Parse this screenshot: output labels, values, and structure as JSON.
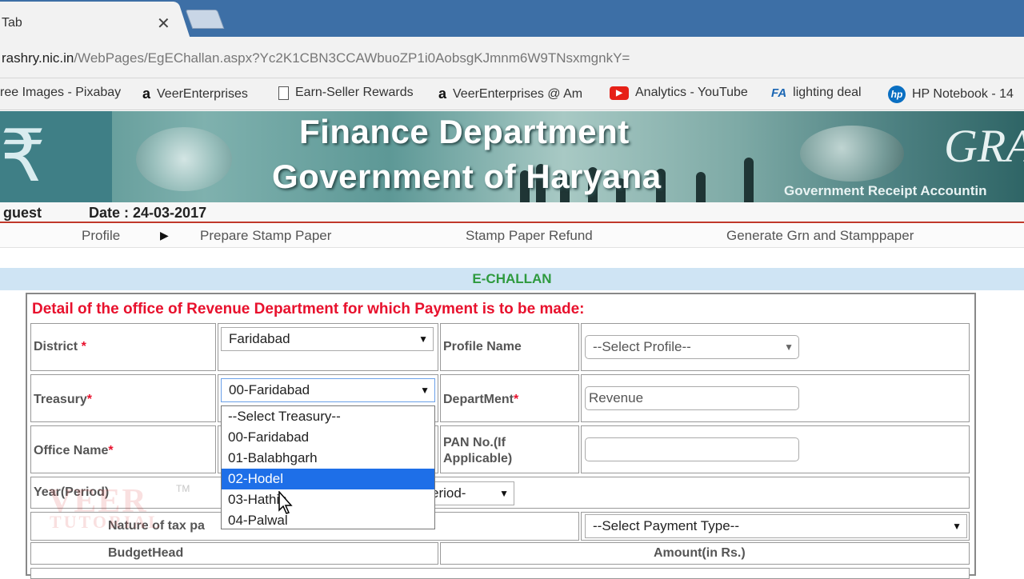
{
  "browser": {
    "tab_title": "Tab",
    "close_glyph": "✕",
    "url_host": "rashry.nic.in",
    "url_path": "/WebPages/EgEChallan.aspx?Yc2K1CBN3CCAWbuoZP1i0AobsgKJmnm6W9TNsxmgnkY=",
    "bookmarks": [
      {
        "label": "ree Images - Pixabay",
        "icon": "pixabay-icon"
      },
      {
        "label": "VeerEnterprises",
        "icon": "amazon-icon"
      },
      {
        "label": "Earn-Seller Rewards",
        "icon": "page-icon"
      },
      {
        "label": "VeerEnterprises @ Am",
        "icon": "amazon-icon"
      },
      {
        "label": "Analytics - YouTube",
        "icon": "youtube-icon"
      },
      {
        "label": "lighting deal",
        "icon": "fa-icon"
      },
      {
        "label": "HP Notebook - 14",
        "icon": "hp-icon"
      }
    ]
  },
  "banner": {
    "line1": "Finance Department",
    "line2": "Government of Haryana",
    "logo_letters": "GRA",
    "subtitle": "Government Receipt Accountin"
  },
  "status": {
    "user": "guest",
    "date": "Date : 24-03-2017"
  },
  "menu": {
    "items": [
      "Profile",
      "Prepare Stamp Paper",
      "Stamp Paper Refund",
      "Generate Grn and Stamppaper"
    ],
    "arrow": "▶"
  },
  "echallan": {
    "header": "E-CHALLAN",
    "section_title": "Detail of the office of Revenue Department for which Payment is to be made:",
    "district_label": "District",
    "district_value": "Faridabad",
    "profile_label": "Profile Name",
    "profile_value": "--Select Profile--",
    "treasury_label": "Treasury",
    "treasury_value": "00-Faridabad",
    "department_label": "DepartMent",
    "department_value": "Revenue",
    "office_label": "Office Name",
    "pan_label_1": "PAN No.(If",
    "pan_label_2": "Applicable)",
    "year_label": "Year(Period)",
    "period_value": "eriod-",
    "nature_label": "Nature of tax pa",
    "payment_type_value": "--Select Payment Type--",
    "budget_head_label": "BudgetHead",
    "amount_label": "Amount(in Rs.)",
    "required_mark": "*",
    "treasury_options": [
      "--Select Treasury--",
      "00-Faridabad",
      "01-Balabhgarh",
      "02-Hodel",
      "03-Hathin",
      "04-Palwal"
    ],
    "treasury_highlighted": "02-Hodel"
  },
  "watermark": {
    "line1": "VEER",
    "line2": "TUTORIAL",
    "tm": "TM"
  },
  "colors": {
    "accent_red": "#e8112d",
    "accent_green": "#2e9a3e",
    "highlight_blue": "#1e6fe8"
  }
}
